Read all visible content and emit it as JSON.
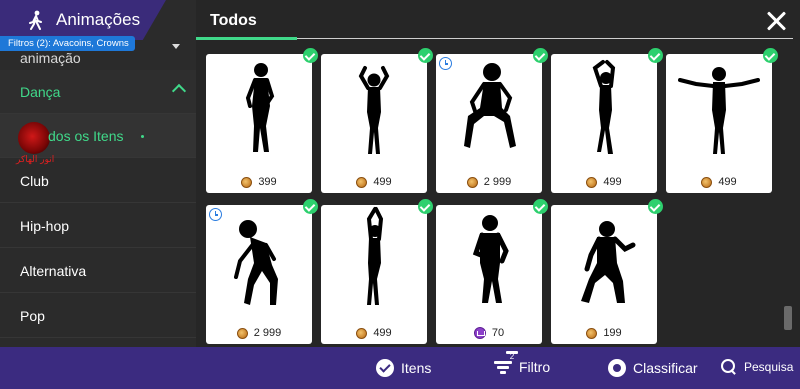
{
  "sidebar": {
    "title": "Animações",
    "filter_badge": "Filtros (2): Avacoins, Crowns",
    "partial_item": "animação",
    "section_label": "Dança",
    "sub_item_label": "dos os Itens",
    "watermark_text": "انور الهاكر",
    "items": [
      {
        "label": "Club"
      },
      {
        "label": "Hip-hop"
      },
      {
        "label": "Alternativa"
      },
      {
        "label": "Pop"
      }
    ]
  },
  "tabs": {
    "active": "Todos"
  },
  "grid": {
    "items": [
      {
        "price": "399",
        "currency": "coin-icon",
        "owned": true,
        "timed": false
      },
      {
        "price": "499",
        "currency": "coin-icon",
        "owned": true,
        "timed": false
      },
      {
        "price": "2 999",
        "currency": "coin-icon",
        "owned": true,
        "timed": true
      },
      {
        "price": "499",
        "currency": "coin-icon",
        "owned": true,
        "timed": false
      },
      {
        "price": "499",
        "currency": "coin-icon",
        "owned": true,
        "timed": false
      },
      {
        "price": "2 999",
        "currency": "coin-icon",
        "owned": true,
        "timed": true
      },
      {
        "price": "499",
        "currency": "coin-icon",
        "owned": true,
        "timed": false
      },
      {
        "price": "70",
        "currency": "crown-icon",
        "owned": true,
        "timed": false
      },
      {
        "price": "199",
        "currency": "coin-icon",
        "owned": true,
        "timed": false
      }
    ]
  },
  "bottom_bar": {
    "items_label": "Itens",
    "filter_label": "Filtro",
    "filter_count": "2",
    "sort_label": "Classificar",
    "search_label": "Pesquisa"
  },
  "colors": {
    "accent_green": "#40d98a",
    "header_purple": "#3a2b7a",
    "bottom_purple": "#3b2b80",
    "badge_blue": "#1e78d8"
  }
}
